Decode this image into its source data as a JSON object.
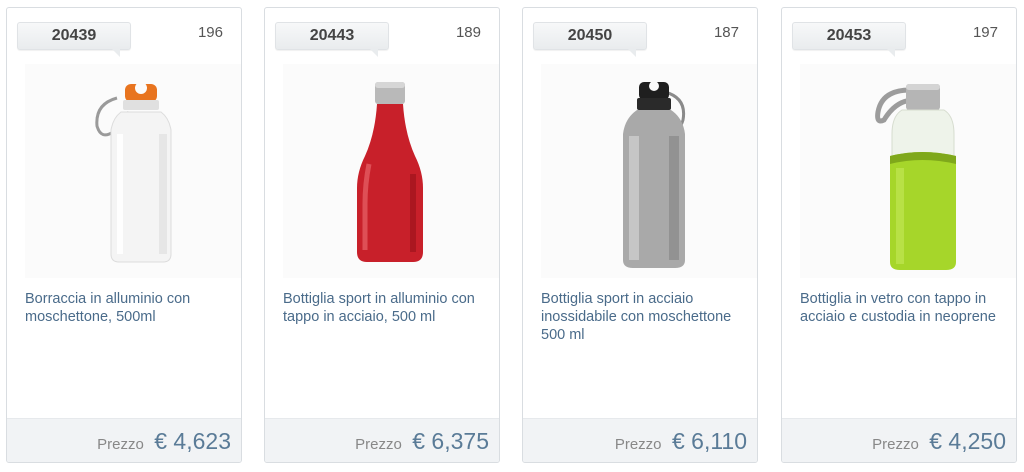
{
  "products": [
    {
      "code": "20439",
      "count": "196",
      "title": "Borraccia in alluminio con moschettone, 500ml",
      "price_label": "Prezzo",
      "price": "€ 4,623",
      "image_icon": "white-aluminium-bottle-icon"
    },
    {
      "code": "20443",
      "count": "189",
      "title": "Bottiglia sport in alluminio con tappo in acciaio, 500 ml",
      "price_label": "Prezzo",
      "price": "€ 6,375",
      "image_icon": "red-bottle-icon"
    },
    {
      "code": "20450",
      "count": "187",
      "title": "Bottiglia sport in acciaio inossidabile con moschettone 500 ml",
      "price_label": "Prezzo",
      "price": "€ 6,110",
      "image_icon": "steel-bottle-icon"
    },
    {
      "code": "20453",
      "count": "197",
      "title": "Bottiglia in vetro con tappo in acciaio e custodia in neoprene",
      "price_label": "Prezzo",
      "price": "€ 4,250",
      "image_icon": "glass-bottle-icon"
    }
  ],
  "colors": {
    "title_link": "#4a6b8a",
    "price_value": "#5a7b97",
    "price_bar": "#f1f3f5"
  }
}
